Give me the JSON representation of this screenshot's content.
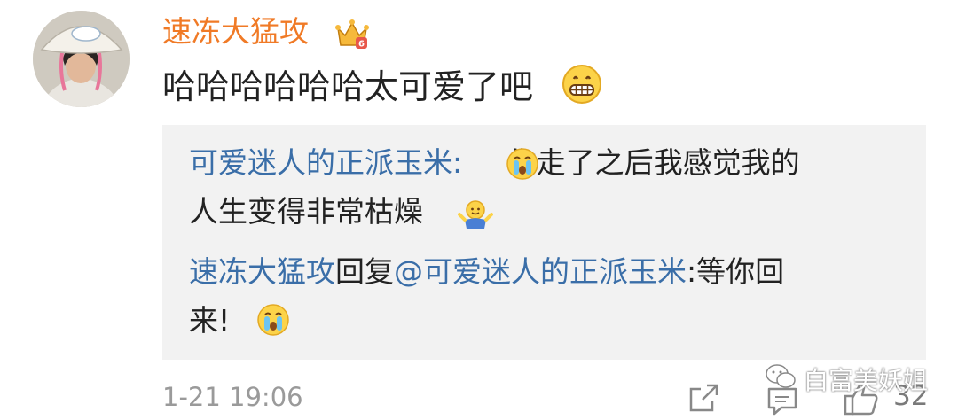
{
  "comment": {
    "author": "速冻大猛攻",
    "text": "哈哈哈哈哈哈太可爱了吧",
    "timestamp": "1-21 19:06",
    "like_count": "32"
  },
  "quote": {
    "original_author": "可爱迷人的正派玉米",
    "original_colon": ": ",
    "original_line1": "你走了之后我感觉我的",
    "original_line2": "人生变得非常枯燥",
    "reply_author": "速冻大猛攻",
    "reply_word": "回复",
    "reply_mention": "@可爱迷人的正派玉米",
    "reply_line1_text": ":等你回",
    "reply_line2_text": "来!"
  },
  "watermark": {
    "text": "白富美妖姐"
  },
  "colors": {
    "username": "#f07a26",
    "link": "#3a6ea8",
    "quote_bg": "#f2f2f2",
    "meta": "#9a9a9a"
  },
  "icons": [
    "crown-badge-icon",
    "grin-emoji",
    "crying-emoji",
    "shrug-emoji",
    "share-icon",
    "comment-icon",
    "thumbs-up-icon",
    "wechat-icon"
  ]
}
